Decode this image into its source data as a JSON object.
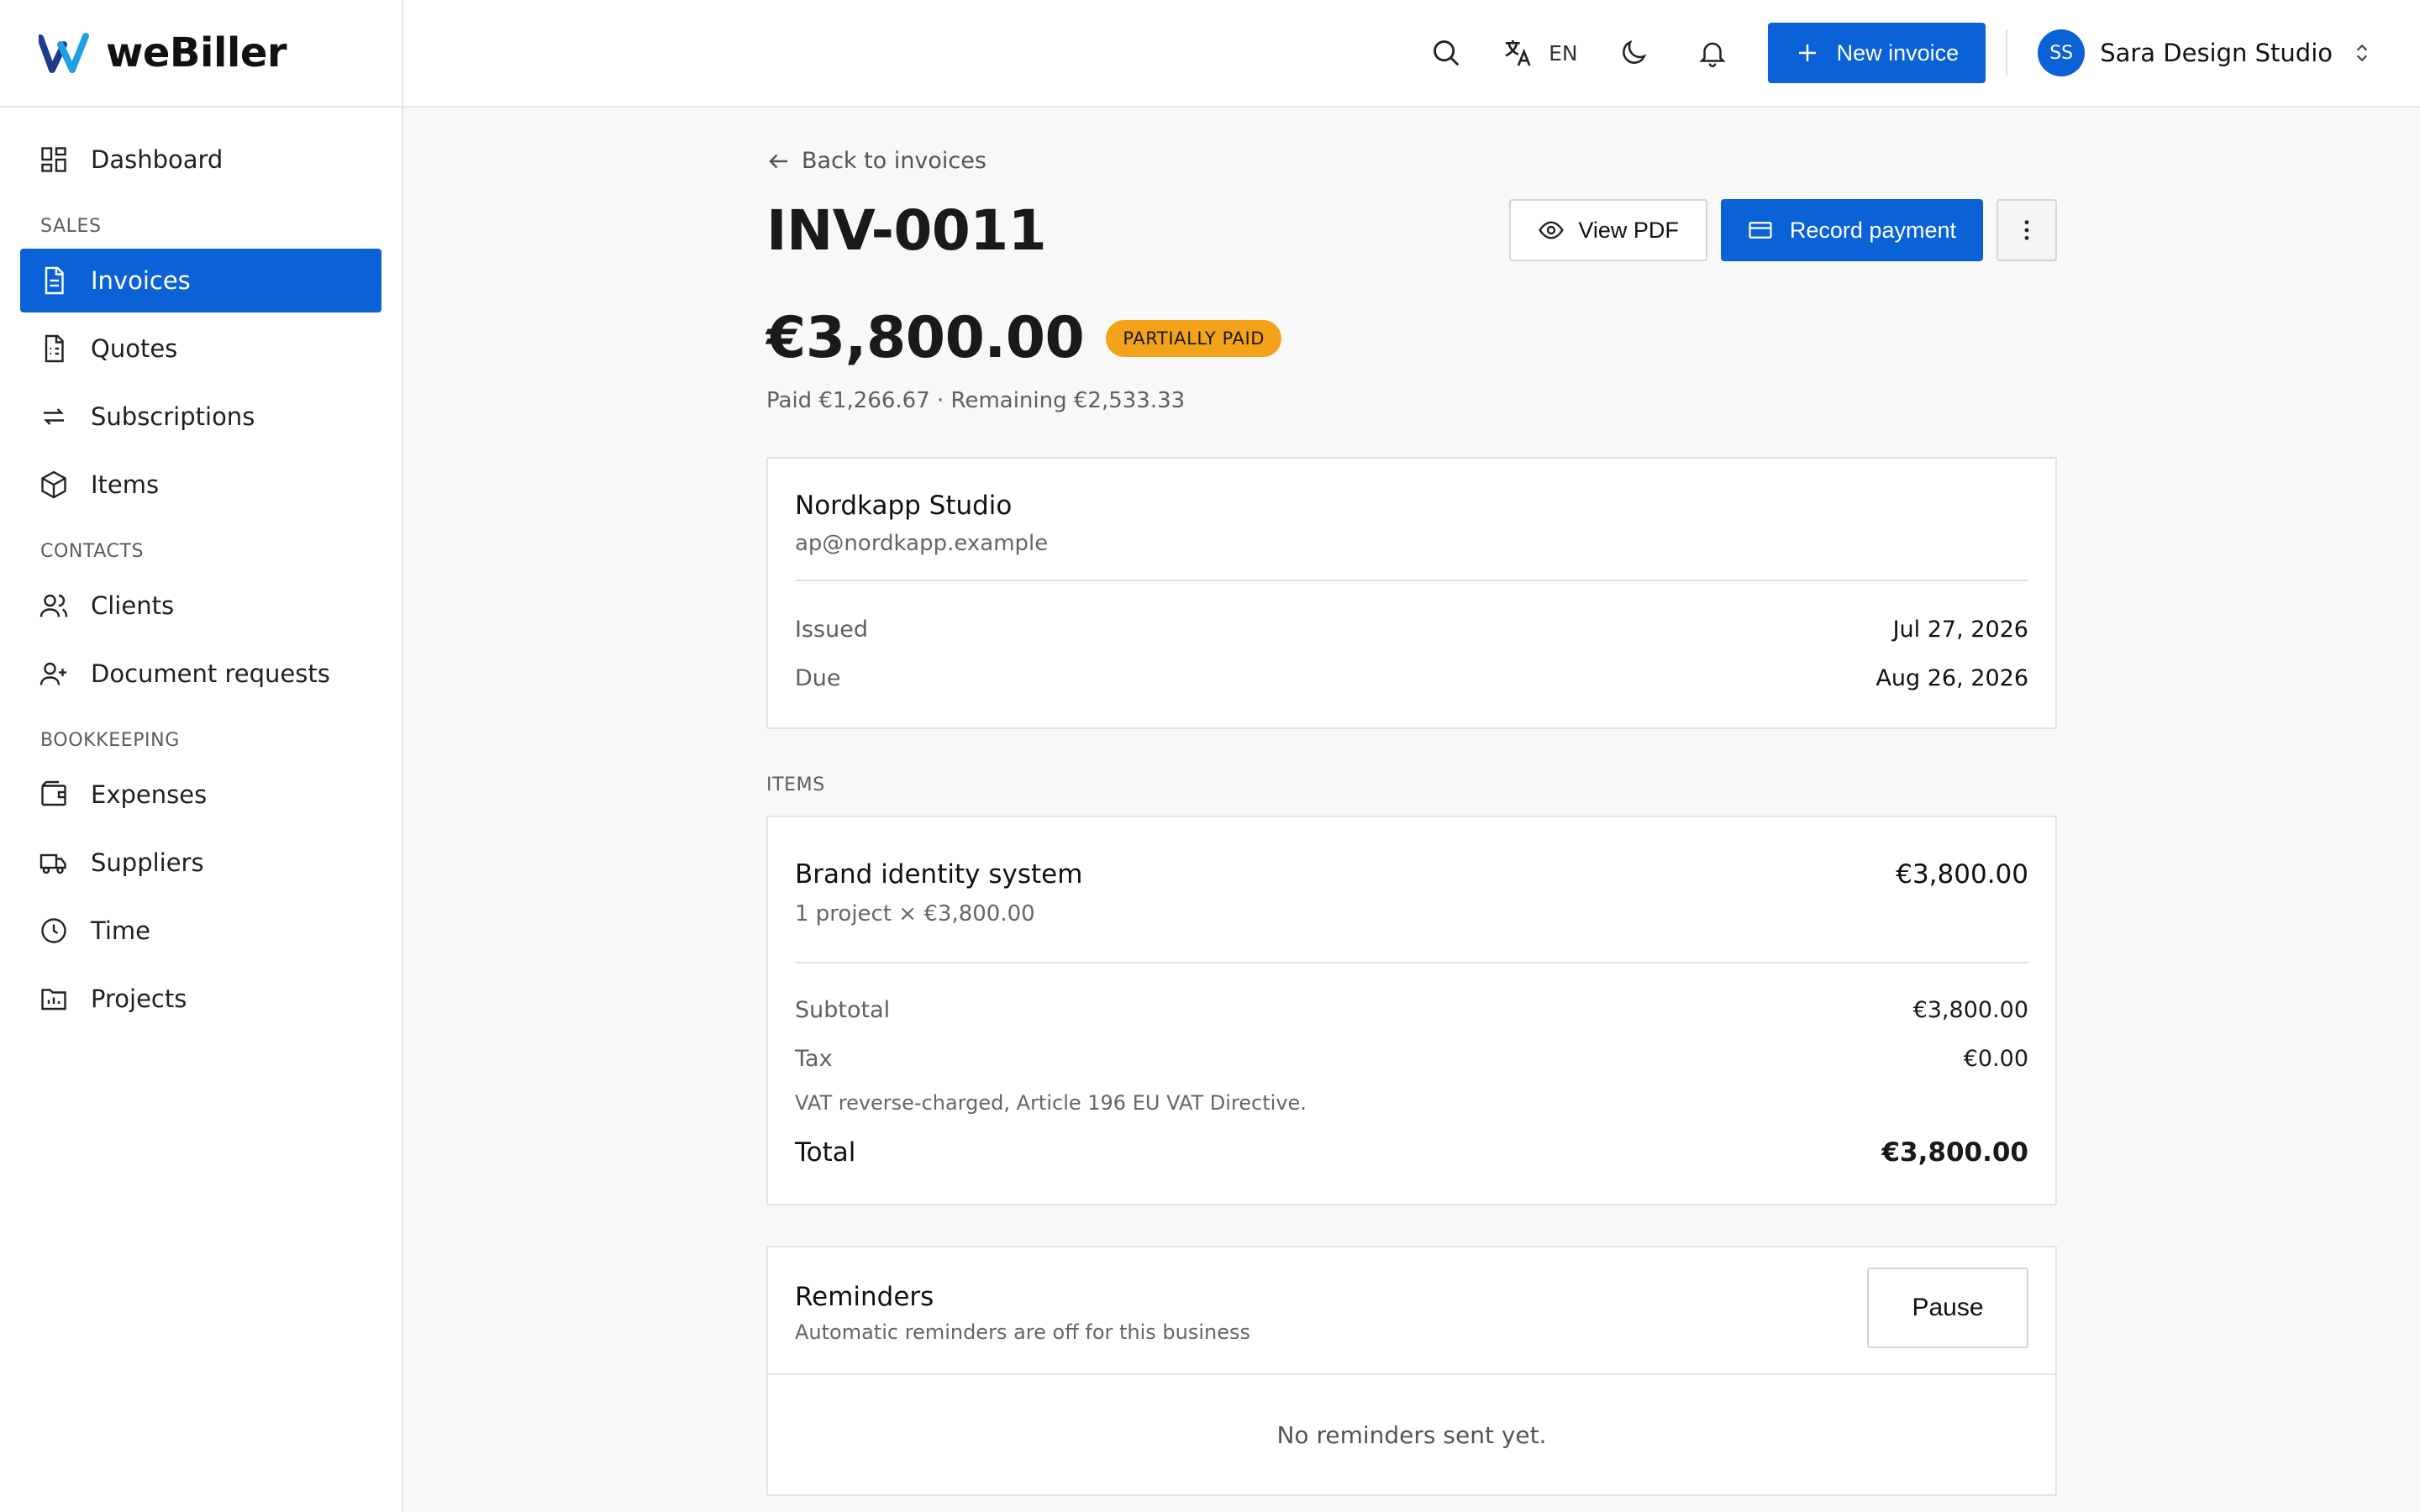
{
  "brand": {
    "name": "weBiller",
    "accent": "#0b62d6",
    "logo_color_dark": "#1e3a8a",
    "logo_color_light": "#1f9fe0"
  },
  "sidebar": {
    "items": [
      {
        "label": "Dashboard",
        "icon": "dashboard-icon"
      },
      {
        "section": "SALES"
      },
      {
        "label": "Invoices",
        "icon": "invoice-icon",
        "active": true
      },
      {
        "label": "Quotes",
        "icon": "quote-icon"
      },
      {
        "label": "Subscriptions",
        "icon": "repeat-icon"
      },
      {
        "label": "Items",
        "icon": "box-icon"
      },
      {
        "section": "CONTACTS"
      },
      {
        "label": "Clients",
        "icon": "users-icon"
      },
      {
        "label": "Document requests",
        "icon": "user-plus-icon"
      },
      {
        "section": "BOOKKEEPING"
      },
      {
        "label": "Expenses",
        "icon": "wallet-icon"
      },
      {
        "label": "Suppliers",
        "icon": "truck-icon"
      },
      {
        "label": "Time",
        "icon": "clock-icon"
      },
      {
        "label": "Projects",
        "icon": "folder-chart-icon"
      }
    ]
  },
  "header": {
    "language": "EN",
    "new_invoice_label": "New invoice",
    "account_initials": "SS",
    "account_name": "Sara Design Studio"
  },
  "invoice": {
    "back_label": "Back to invoices",
    "number": "INV-0011",
    "view_pdf_label": "View PDF",
    "record_payment_label": "Record payment",
    "amount": "€3,800.00",
    "status": "PARTIALLY PAID",
    "status_color": "#f3a21a",
    "paid_summary": "Paid €1,266.67 · Remaining €2,533.33",
    "client": {
      "name": "Nordkapp Studio",
      "email": "ap@nordkapp.example"
    },
    "issued_label": "Issued",
    "issued_date": "Jul 27, 2026",
    "due_label": "Due",
    "due_date": "Aug 26, 2026",
    "items_label": "ITEMS",
    "items": [
      {
        "name": "Brand identity system",
        "qty": "1 project × €3,800.00",
        "amount": "€3,800.00"
      }
    ],
    "subtotal_label": "Subtotal",
    "subtotal": "€3,800.00",
    "tax_label": "Tax",
    "tax": "€0.00",
    "tax_note": "VAT reverse-charged, Article 196 EU VAT Directive.",
    "total_label": "Total",
    "total": "€3,800.00"
  },
  "reminders": {
    "title": "Reminders",
    "subtitle": "Automatic reminders are off for this business",
    "pause_label": "Pause",
    "empty_text": "No reminders sent yet."
  }
}
